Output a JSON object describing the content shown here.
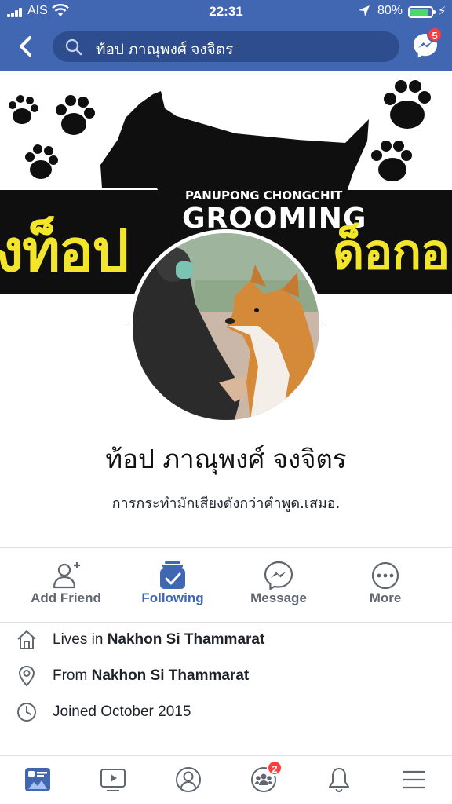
{
  "status_bar": {
    "carrier": "AIS",
    "time": "22:31",
    "battery": "80%"
  },
  "header": {
    "search_text": "ท้อป ภาณุพงศ์ จงจิตร",
    "messenger_badge": "5"
  },
  "cover": {
    "text_left": "งท็อป",
    "brand_top": "PANUPONG CHONGCHIT",
    "brand_main": "GROOMING",
    "text_right": "ด็อกอ"
  },
  "profile": {
    "name": "ท้อป ภาณุพงศ์ จงจิตร",
    "bio": "การกระทำมักเสียงดังกว่าคำพูด.เสมอ."
  },
  "actions": [
    {
      "label": "Add Friend",
      "icon": "add-friend-icon"
    },
    {
      "label": "Following",
      "icon": "following-icon"
    },
    {
      "label": "Message",
      "icon": "messenger-icon"
    },
    {
      "label": "More",
      "icon": "more-icon"
    }
  ],
  "info": [
    {
      "prefix": "Lives in ",
      "value": "Nakhon Si Thammarat",
      "icon": "home-icon"
    },
    {
      "prefix": "From ",
      "value": "Nakhon Si Thammarat",
      "icon": "location-pin-icon"
    },
    {
      "prefix": "Joined October 2015",
      "value": "",
      "icon": "clock-icon"
    }
  ],
  "tabbar": {
    "groups_badge": "2",
    "tabs": [
      "news-feed-icon",
      "watch-icon",
      "profile-icon",
      "groups-icon",
      "notifications-icon",
      "menu-icon"
    ]
  },
  "colors": {
    "brand_blue": "#4267b2",
    "search_bg": "#2d4d8f",
    "badge_red": "#fa3e3e",
    "cover_yellow": "#f2e52a",
    "battery_green": "#4cd964"
  }
}
